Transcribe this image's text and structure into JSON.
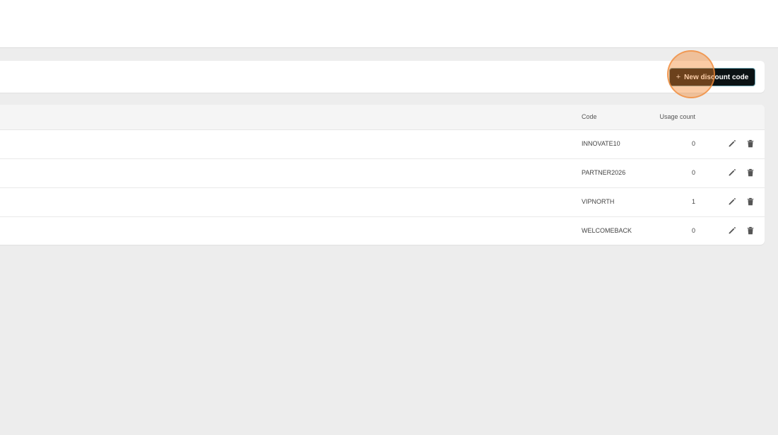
{
  "toolbar": {
    "new_button_plus": "+",
    "new_button_label": "New discount code"
  },
  "table": {
    "columns": {
      "code": "Code",
      "usage": "Usage count"
    },
    "rows": [
      {
        "code": "INNOVATE10",
        "usage": "0"
      },
      {
        "code": "PARTNER2026",
        "usage": "0"
      },
      {
        "code": "VIPNORTH",
        "usage": "1"
      },
      {
        "code": "WELCOMEBACK",
        "usage": "0"
      }
    ]
  },
  "icons": {
    "edit": "pencil-icon",
    "delete": "trash-icon"
  },
  "colors": {
    "background": "#ededed",
    "primary_button": "#0b1214",
    "click_highlight": "#f4822a"
  }
}
